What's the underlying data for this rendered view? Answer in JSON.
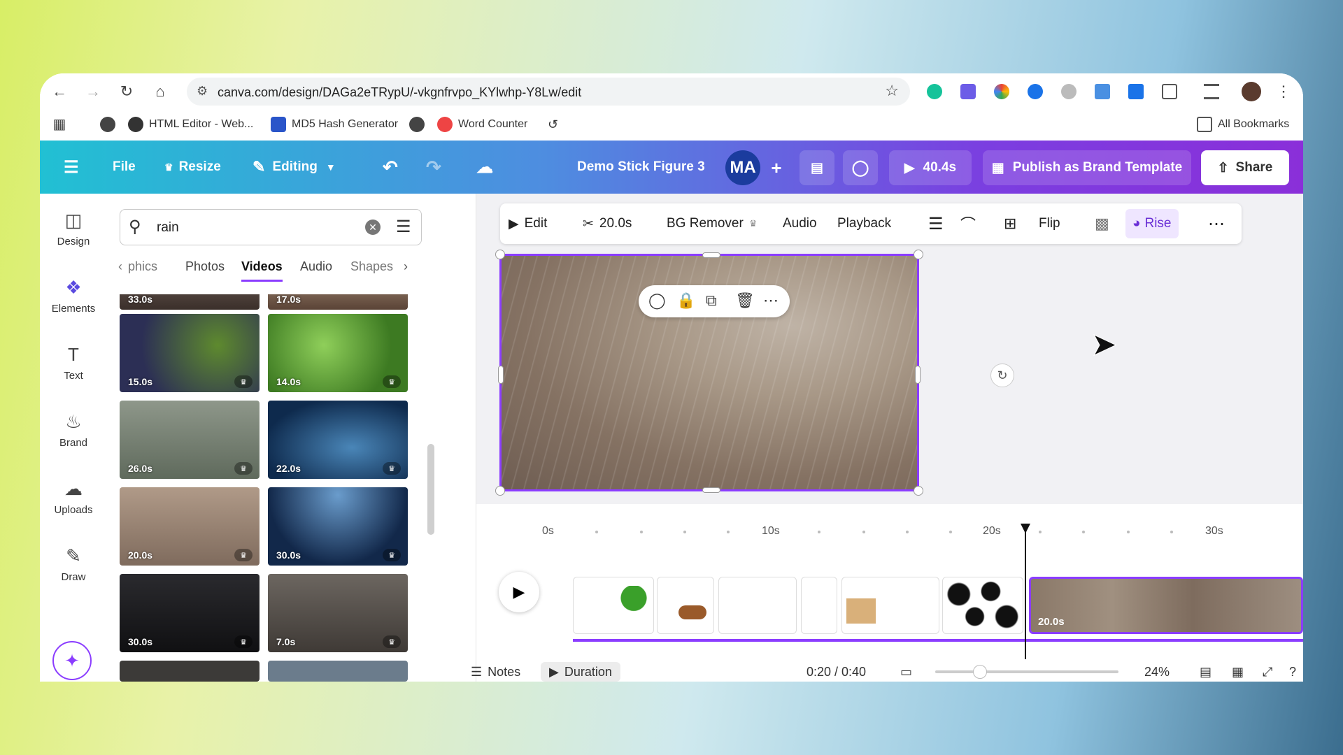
{
  "browser": {
    "url": "canva.com/design/DAGa2eTRypU/-vkgnfrvpo_KYlwhp-Y8Lw/edit",
    "bookmarks": [
      {
        "label": "HTML Editor - Web..."
      },
      {
        "label": "MD5 Hash Generator"
      },
      {
        "label": "Word Counter"
      }
    ],
    "all_bookmarks": "All Bookmarks"
  },
  "topbar": {
    "file": "File",
    "resize": "Resize",
    "editing": "Editing",
    "title": "Demo Stick Figure 3",
    "avatar": "MA",
    "play_time": "40.4s",
    "publish": "Publish as Brand Template",
    "share": "Share",
    "accent": "#8b3dff"
  },
  "rail": [
    {
      "label": "Design",
      "icon": "design-icon"
    },
    {
      "label": "Elements",
      "icon": "elements-icon"
    },
    {
      "label": "Text",
      "icon": "text-icon"
    },
    {
      "label": "Brand",
      "icon": "brand-icon"
    },
    {
      "label": "Uploads",
      "icon": "uploads-icon"
    },
    {
      "label": "Draw",
      "icon": "draw-icon"
    }
  ],
  "panel": {
    "search_value": "rain",
    "tabs": [
      "phics",
      "Photos",
      "Videos",
      "Audio",
      "Shapes"
    ],
    "active_tab": "Videos",
    "durations": [
      "33.0s",
      "17.0s",
      "15.0s",
      "14.0s",
      "26.0s",
      "22.0s",
      "20.0s",
      "30.0s",
      "30.0s",
      "7.0s"
    ]
  },
  "toolbar": {
    "edit": "Edit",
    "trim": "20.0s",
    "bg_remover": "BG Remover",
    "audio": "Audio",
    "playback": "Playback",
    "flip": "Flip",
    "rise": "Rise"
  },
  "timeline": {
    "ticks": [
      "0s",
      "10s",
      "20s",
      "30s"
    ],
    "selected_clip": "20.0s",
    "notes": "Notes",
    "duration": "Duration",
    "time": "0:20 / 0:40",
    "zoom": "24%"
  }
}
